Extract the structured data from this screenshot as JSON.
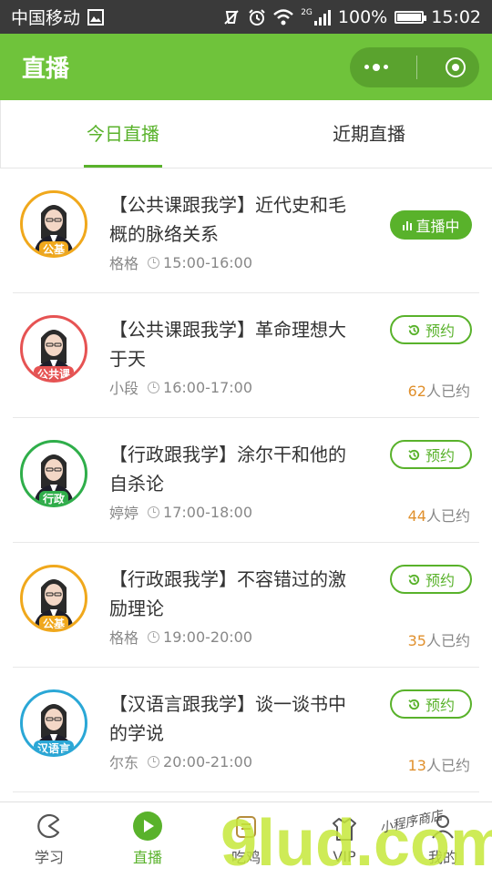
{
  "status_bar": {
    "carrier": "中国移动",
    "network": "2G",
    "battery": "100%",
    "battery_level": 1.0,
    "time": "15:02"
  },
  "nav": {
    "title": "直播"
  },
  "tabs": [
    {
      "label": "今日直播",
      "active": true
    },
    {
      "label": "近期直播",
      "active": false
    }
  ],
  "items": [
    {
      "title": "【公共课跟我学】近代史和毛概的脉络关系",
      "teacher": "格格",
      "time": "15:00-16:00",
      "badge": "公基",
      "ring_color": "#f0a81c",
      "status": "live",
      "status_label": "直播中"
    },
    {
      "title": "【公共课跟我学】革命理想大于天",
      "teacher": "小段",
      "time": "16:00-17:00",
      "badge": "公共课",
      "ring_color": "#e65353",
      "status": "book",
      "status_label": "预约",
      "booked_count": "62",
      "booked_suffix": "人已约"
    },
    {
      "title": "【行政跟我学】涂尔干和他的自杀论",
      "teacher": "婷婷",
      "time": "17:00-18:00",
      "badge": "行政",
      "ring_color": "#2fae4a",
      "status": "book",
      "status_label": "预约",
      "booked_count": "44",
      "booked_suffix": "人已约"
    },
    {
      "title": "【行政跟我学】不容错过的激励理论",
      "teacher": "格格",
      "time": "19:00-20:00",
      "badge": "公基",
      "ring_color": "#f0a81c",
      "status": "book",
      "status_label": "预约",
      "booked_count": "35",
      "booked_suffix": "人已约"
    },
    {
      "title": "【汉语言跟我学】谈一谈书中的学说",
      "teacher": "尔东",
      "time": "20:00-21:00",
      "badge": "汉语言",
      "ring_color": "#2aa7d6",
      "status": "book",
      "status_label": "预约",
      "booked_count": "13",
      "booked_suffix": "人已约"
    }
  ],
  "tabbar": [
    {
      "label": "学习",
      "icon": "pacman-icon",
      "active": false
    },
    {
      "label": "直播",
      "icon": "play-icon",
      "active": true
    },
    {
      "label": "吃鸡",
      "icon": "chicken-icon",
      "active": false
    },
    {
      "label": "VIP",
      "icon": "vip-icon",
      "active": false
    },
    {
      "label": "我的",
      "icon": "user-icon",
      "active": false
    }
  ],
  "watermark": {
    "text": "9lud.com",
    "subtext": "小程序商店"
  },
  "colors": {
    "brand": "#6fc33b",
    "accent": "#59b22b",
    "count": "#e0902d"
  }
}
